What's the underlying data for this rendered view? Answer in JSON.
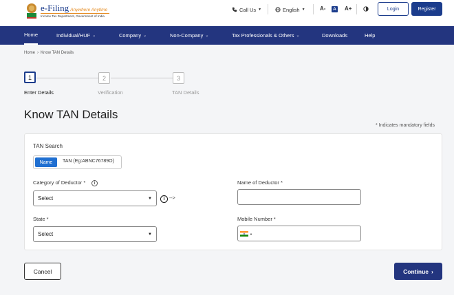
{
  "header": {
    "logo_title": "e-Filing",
    "logo_tagline": "Anywhere Anytime",
    "logo_subtitle": "Income Tax Department, Government of India",
    "call_us": "Call Us",
    "language": "English",
    "font_decrease": "A-",
    "font_normal": "A",
    "font_increase": "A+",
    "login_label": "Login",
    "register_label": "Register",
    "brand_color": "#23357f"
  },
  "nav": {
    "items": [
      {
        "label": "Home"
      },
      {
        "label": "Individual/HUF"
      },
      {
        "label": "Company"
      },
      {
        "label": "Non-Company"
      },
      {
        "label": "Tax Professionals & Others"
      },
      {
        "label": "Downloads"
      },
      {
        "label": "Help"
      }
    ]
  },
  "breadcrumb": {
    "home": "Home",
    "separator": "›",
    "current": "Know TAN Details"
  },
  "stepper": {
    "steps": [
      {
        "number": "1",
        "label": "Enter Details"
      },
      {
        "number": "2",
        "label": "Verification"
      },
      {
        "number": "3",
        "label": "TAN Details"
      }
    ]
  },
  "page": {
    "title": "Know TAN Details",
    "mandatory_note": "* Indicates mandatory fields"
  },
  "form": {
    "search_heading": "TAN Search",
    "toggle_name": "Name",
    "toggle_tan": "TAN (Eg:ABNC76789O)",
    "category_label": "Category of Deductor *",
    "category_value": "Select",
    "arrow_text": "-->",
    "state_label": "State *",
    "state_value": "Select",
    "deductor_name_label": "Name of Deductor *",
    "mobile_label": "Mobile Number *"
  },
  "actions": {
    "cancel_label": "Cancel",
    "continue_label": "Continue",
    "continue_chevron": "›"
  }
}
